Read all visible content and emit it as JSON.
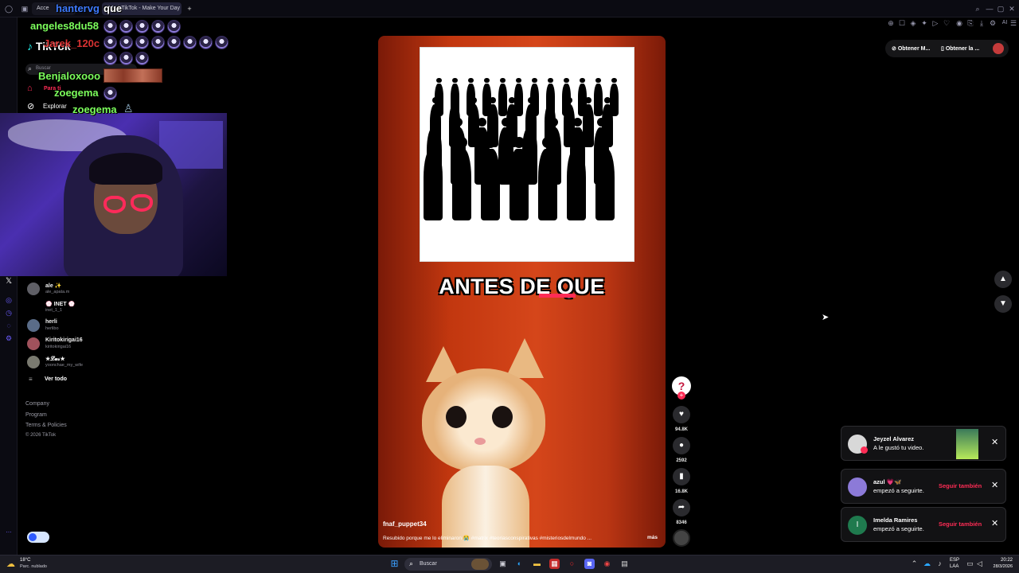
{
  "browser": {
    "tab_active": "(99+) TikTok - Make Your Day",
    "tab_inactive": "Acce",
    "new_tab": "+",
    "toolbar_extra": "AI"
  },
  "chat_overlay": {
    "lines": [
      {
        "user": "angeles8du58",
        "color": "#7cff5c"
      },
      {
        "user": "hantervg",
        "color": "#3e7bff"
      },
      {
        "user": "que",
        "color": "#ffffff"
      },
      {
        "user": "Jarek_120c",
        "color": "#ff3b3b"
      },
      {
        "user": "Benjaloxooo",
        "color": "#7cff5c"
      },
      {
        "user": "zoegema",
        "color": "#7cff5c"
      },
      {
        "user": "zoegema",
        "color": "#7cff5c"
      }
    ]
  },
  "tiktok": {
    "logo": "TikTok",
    "search_placeholder": "Buscar",
    "nav": [
      {
        "label": "Para ti",
        "icon": "home-icon",
        "active": true
      },
      {
        "label": "Explorar",
        "icon": "compass-icon",
        "active": false
      }
    ],
    "following": [
      {
        "name": "ale ✨",
        "handle": "ale_apata.m"
      },
      {
        "name": "💮 INET 💮",
        "handle": "inet_1_1"
      },
      {
        "name": "herli",
        "handle": "herlibo"
      },
      {
        "name": "Kiritokirigai16",
        "handle": "kiritokirigai16"
      },
      {
        "name": "★𝓛𝓾𝓼★",
        "handle": "yoonchae_my_wife"
      }
    ],
    "see_all": "Ver todo",
    "footer": [
      "Company",
      "Program",
      "Terms & Policies",
      "© 2026 TikTok"
    ],
    "header_buttons": [
      "Obtener M...",
      "Obtener la ..."
    ]
  },
  "video": {
    "caption_overlay": "ANTES DE QUE",
    "author": "fnaf_puppet34",
    "description": "Resubido porque me lo eliminaron 😭 #matrix #teoriasconspirativas #misteriosdelmundo ...",
    "more": "más",
    "likes": "94.8K",
    "comments": "2592",
    "saves": "16.8K",
    "shares": "8346"
  },
  "notifications": [
    {
      "name": "Jeyzel Alvarez",
      "text": "A le gustó tu video.",
      "action": "",
      "avatar_color": "#d8d8d8"
    },
    {
      "name": "azul 💗🦋",
      "text": "empezó a seguirte.",
      "action": "Seguir también",
      "avatar_color": "#8c7ad8"
    },
    {
      "name": "Imelda Ramires",
      "text": "empezó a seguirte.",
      "action": "Seguir también",
      "avatar_color": "#1f7a4e",
      "initial": "I"
    }
  ],
  "taskbar": {
    "weather_temp": "18°C",
    "weather_desc": "Parc. nublado",
    "search": "Buscar",
    "lang": "ESP",
    "lang2": "LAA",
    "time": "20:22",
    "date": "28/3/2026"
  }
}
